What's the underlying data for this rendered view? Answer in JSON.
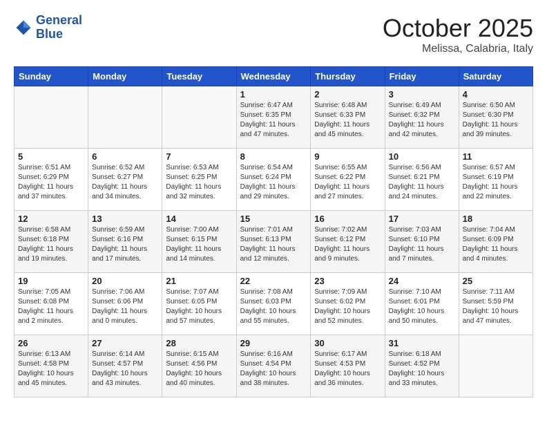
{
  "logo": {
    "line1": "General",
    "line2": "Blue"
  },
  "title": "October 2025",
  "location": "Melissa, Calabria, Italy",
  "weekdays": [
    "Sunday",
    "Monday",
    "Tuesday",
    "Wednesday",
    "Thursday",
    "Friday",
    "Saturday"
  ],
  "weeks": [
    [
      {
        "day": "",
        "info": ""
      },
      {
        "day": "",
        "info": ""
      },
      {
        "day": "",
        "info": ""
      },
      {
        "day": "1",
        "info": "Sunrise: 6:47 AM\nSunset: 6:35 PM\nDaylight: 11 hours\nand 47 minutes."
      },
      {
        "day": "2",
        "info": "Sunrise: 6:48 AM\nSunset: 6:33 PM\nDaylight: 11 hours\nand 45 minutes."
      },
      {
        "day": "3",
        "info": "Sunrise: 6:49 AM\nSunset: 6:32 PM\nDaylight: 11 hours\nand 42 minutes."
      },
      {
        "day": "4",
        "info": "Sunrise: 6:50 AM\nSunset: 6:30 PM\nDaylight: 11 hours\nand 39 minutes."
      }
    ],
    [
      {
        "day": "5",
        "info": "Sunrise: 6:51 AM\nSunset: 6:29 PM\nDaylight: 11 hours\nand 37 minutes."
      },
      {
        "day": "6",
        "info": "Sunrise: 6:52 AM\nSunset: 6:27 PM\nDaylight: 11 hours\nand 34 minutes."
      },
      {
        "day": "7",
        "info": "Sunrise: 6:53 AM\nSunset: 6:25 PM\nDaylight: 11 hours\nand 32 minutes."
      },
      {
        "day": "8",
        "info": "Sunrise: 6:54 AM\nSunset: 6:24 PM\nDaylight: 11 hours\nand 29 minutes."
      },
      {
        "day": "9",
        "info": "Sunrise: 6:55 AM\nSunset: 6:22 PM\nDaylight: 11 hours\nand 27 minutes."
      },
      {
        "day": "10",
        "info": "Sunrise: 6:56 AM\nSunset: 6:21 PM\nDaylight: 11 hours\nand 24 minutes."
      },
      {
        "day": "11",
        "info": "Sunrise: 6:57 AM\nSunset: 6:19 PM\nDaylight: 11 hours\nand 22 minutes."
      }
    ],
    [
      {
        "day": "12",
        "info": "Sunrise: 6:58 AM\nSunset: 6:18 PM\nDaylight: 11 hours\nand 19 minutes."
      },
      {
        "day": "13",
        "info": "Sunrise: 6:59 AM\nSunset: 6:16 PM\nDaylight: 11 hours\nand 17 minutes."
      },
      {
        "day": "14",
        "info": "Sunrise: 7:00 AM\nSunset: 6:15 PM\nDaylight: 11 hours\nand 14 minutes."
      },
      {
        "day": "15",
        "info": "Sunrise: 7:01 AM\nSunset: 6:13 PM\nDaylight: 11 hours\nand 12 minutes."
      },
      {
        "day": "16",
        "info": "Sunrise: 7:02 AM\nSunset: 6:12 PM\nDaylight: 11 hours\nand 9 minutes."
      },
      {
        "day": "17",
        "info": "Sunrise: 7:03 AM\nSunset: 6:10 PM\nDaylight: 11 hours\nand 7 minutes."
      },
      {
        "day": "18",
        "info": "Sunrise: 7:04 AM\nSunset: 6:09 PM\nDaylight: 11 hours\nand 4 minutes."
      }
    ],
    [
      {
        "day": "19",
        "info": "Sunrise: 7:05 AM\nSunset: 6:08 PM\nDaylight: 11 hours\nand 2 minutes."
      },
      {
        "day": "20",
        "info": "Sunrise: 7:06 AM\nSunset: 6:06 PM\nDaylight: 11 hours\nand 0 minutes."
      },
      {
        "day": "21",
        "info": "Sunrise: 7:07 AM\nSunset: 6:05 PM\nDaylight: 10 hours\nand 57 minutes."
      },
      {
        "day": "22",
        "info": "Sunrise: 7:08 AM\nSunset: 6:03 PM\nDaylight: 10 hours\nand 55 minutes."
      },
      {
        "day": "23",
        "info": "Sunrise: 7:09 AM\nSunset: 6:02 PM\nDaylight: 10 hours\nand 52 minutes."
      },
      {
        "day": "24",
        "info": "Sunrise: 7:10 AM\nSunset: 6:01 PM\nDaylight: 10 hours\nand 50 minutes."
      },
      {
        "day": "25",
        "info": "Sunrise: 7:11 AM\nSunset: 5:59 PM\nDaylight: 10 hours\nand 47 minutes."
      }
    ],
    [
      {
        "day": "26",
        "info": "Sunrise: 6:13 AM\nSunset: 4:58 PM\nDaylight: 10 hours\nand 45 minutes."
      },
      {
        "day": "27",
        "info": "Sunrise: 6:14 AM\nSunset: 4:57 PM\nDaylight: 10 hours\nand 43 minutes."
      },
      {
        "day": "28",
        "info": "Sunrise: 6:15 AM\nSunset: 4:56 PM\nDaylight: 10 hours\nand 40 minutes."
      },
      {
        "day": "29",
        "info": "Sunrise: 6:16 AM\nSunset: 4:54 PM\nDaylight: 10 hours\nand 38 minutes."
      },
      {
        "day": "30",
        "info": "Sunrise: 6:17 AM\nSunset: 4:53 PM\nDaylight: 10 hours\nand 36 minutes."
      },
      {
        "day": "31",
        "info": "Sunrise: 6:18 AM\nSunset: 4:52 PM\nDaylight: 10 hours\nand 33 minutes."
      },
      {
        "day": "",
        "info": ""
      }
    ]
  ]
}
